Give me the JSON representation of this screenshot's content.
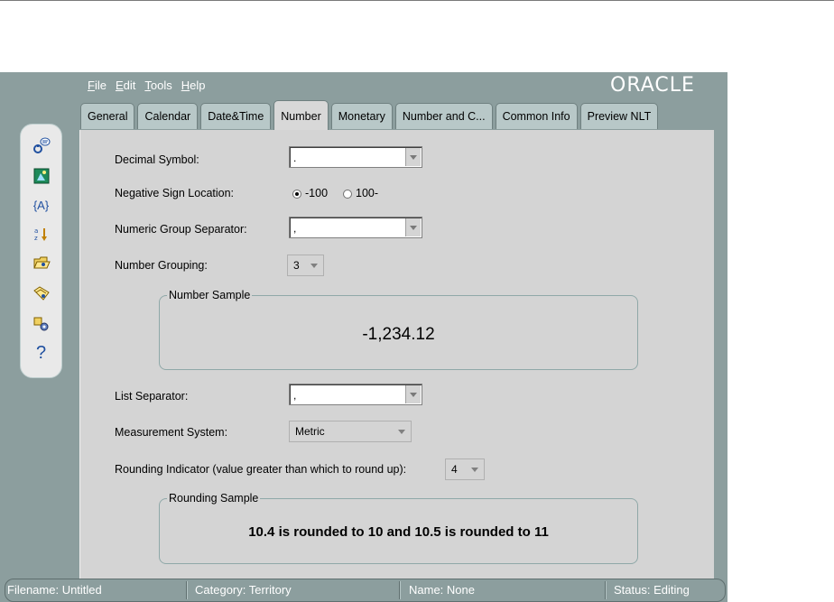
{
  "app": {
    "logo": "ORACLE",
    "menu": [
      {
        "label": "File",
        "mnemonic": "F",
        "rest": "ile"
      },
      {
        "label": "Edit",
        "mnemonic": "E",
        "rest": "dit"
      },
      {
        "label": "Tools",
        "mnemonic": "T",
        "rest": "ools"
      },
      {
        "label": "Help",
        "mnemonic": "H",
        "rest": "elp"
      }
    ]
  },
  "tabs": [
    {
      "label": "General",
      "active": false
    },
    {
      "label": "Calendar",
      "active": false
    },
    {
      "label": "Date&Time",
      "active": false
    },
    {
      "label": "Number",
      "active": true
    },
    {
      "label": "Monetary",
      "active": false
    },
    {
      "label": "Number and C...",
      "active": false
    },
    {
      "label": "Common Info",
      "active": false
    },
    {
      "label": "Preview NLT",
      "active": false
    }
  ],
  "toolbar": {
    "icons": [
      "info-icon",
      "image-icon",
      "variable-icon",
      "sort-icon",
      "open-icon",
      "save-icon",
      "settings-icon",
      "help-icon"
    ],
    "variable_glyph": "{A}",
    "help_glyph": "?"
  },
  "form": {
    "decimal_symbol": {
      "label": "Decimal Symbol:",
      "value": "."
    },
    "negative_sign": {
      "label": "Negative Sign Location:",
      "options": [
        "-100",
        "100-"
      ],
      "selected": "-100"
    },
    "group_separator": {
      "label": "Numeric Group Separator:",
      "value": ","
    },
    "number_grouping": {
      "label": "Number Grouping:",
      "value": "3"
    },
    "number_sample": {
      "title": "Number Sample",
      "value": "-1,234.12"
    },
    "list_separator": {
      "label": "List Separator:",
      "value": ","
    },
    "measurement": {
      "label": "Measurement System:",
      "value": "Metric"
    },
    "rounding": {
      "label": "Rounding Indicator (value greater than which to round up):",
      "value": "4"
    },
    "rounding_sample": {
      "title": "Rounding Sample",
      "value": "10.4 is rounded to 10 and 10.5 is rounded to 11"
    }
  },
  "status": {
    "filename": "Filename: Untitled",
    "category": "Category: Territory",
    "name": "Name: None",
    "state": "Status: Editing"
  }
}
